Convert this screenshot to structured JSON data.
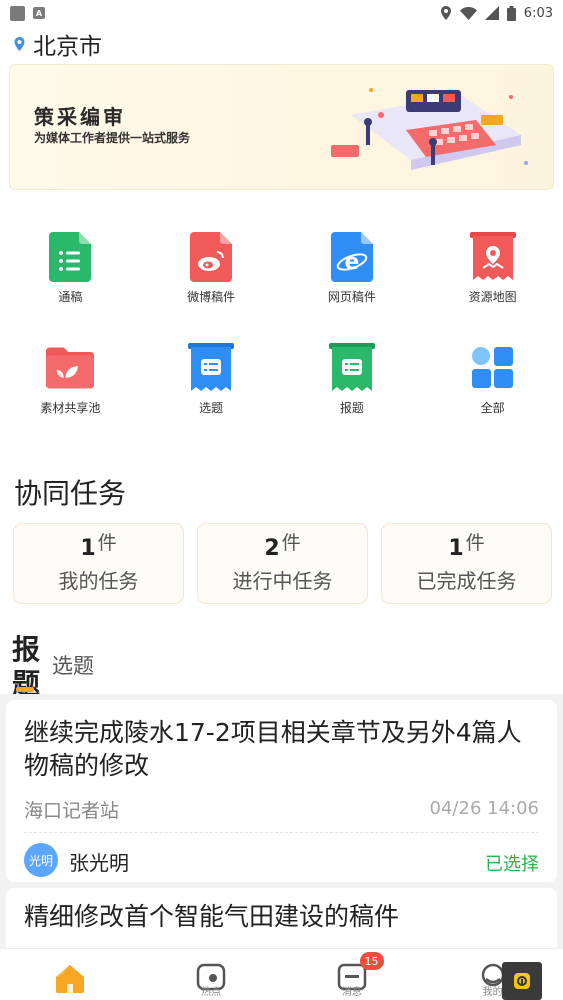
{
  "status_bar": {
    "time": "6:03"
  },
  "location": {
    "city": "北京市"
  },
  "banner": {
    "title": "策采编审",
    "subtitle": "为媒体工作者提供一站式服务"
  },
  "grid": [
    {
      "label": "通稿",
      "icon": "document-list-icon",
      "color": "#2ab86a"
    },
    {
      "label": "微博稿件",
      "icon": "weibo-icon",
      "color": "#f25a5a"
    },
    {
      "label": "网页稿件",
      "icon": "ie-icon",
      "color": "#2f8ef5"
    },
    {
      "label": "资源地图",
      "icon": "map-icon",
      "color": "#f25a5a"
    },
    {
      "label": "素材共享池",
      "icon": "folder-icon",
      "color": "#f25a5a"
    },
    {
      "label": "选题",
      "icon": "topic-icon",
      "color": "#2f8ef5"
    },
    {
      "label": "报题",
      "icon": "report-icon",
      "color": "#2ab86a"
    },
    {
      "label": "全部",
      "icon": "all-apps-icon",
      "color": "#2f8ef5"
    }
  ],
  "collab": {
    "title": "协同任务",
    "cards": [
      {
        "count": "1",
        "unit": "件",
        "label": "我的任务"
      },
      {
        "count": "2",
        "unit": "件",
        "label": "进行中任务"
      },
      {
        "count": "1",
        "unit": "件",
        "label": "已完成任务"
      }
    ]
  },
  "tabs": {
    "active": "报题",
    "inactive": "选题"
  },
  "list": [
    {
      "title": "继续完成陵水17-2项目相关章节及另外4篇人物稿的修改",
      "org": "海口记者站",
      "time": "04/26 14:06",
      "avatar": "光明",
      "person": "张光明",
      "status": "已选择"
    },
    {
      "title": "精细修改首个智能气田建设的稿件"
    }
  ],
  "bottom_nav": [
    {
      "label": "",
      "icon": "home-icon",
      "active": true
    },
    {
      "label": "热点",
      "icon": "hotspot-icon"
    },
    {
      "label": "消息",
      "icon": "message-icon",
      "badge": "15"
    },
    {
      "label": "我的",
      "icon": "profile-icon"
    }
  ]
}
